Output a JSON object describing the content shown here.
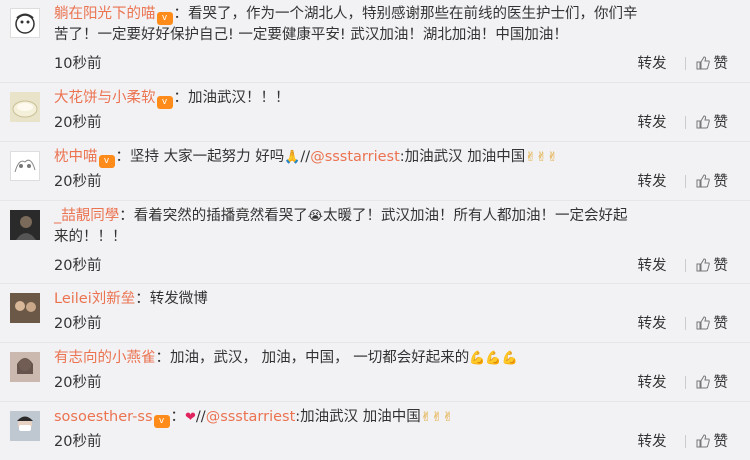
{
  "labels": {
    "repost": "转发",
    "like": "赞"
  },
  "comments": [
    {
      "user": "躺在阳光下的喵",
      "text_parts": [
        "：看哭了，作为一个湖北人，特别感谢那些在前线的医生护士们，你们辛",
        "苦了！一定要好好保护自己! 一定要健康平安! 武汉加油！湖北加油！中国加油！"
      ],
      "time": "10秒前",
      "avatar_icon": "cartoon-face-avatar"
    },
    {
      "user": "大花饼与小柔软",
      "text": "：加油武汉！！！",
      "time": "20秒前",
      "avatar_icon": "food-avatar"
    },
    {
      "user": "枕中喵",
      "text": "：坚持 大家一起努力 好吗",
      "emoji": "🙏",
      "repost_sep": "//",
      "mention": "@ssstarriest",
      "text2": ":加油武汉 加油中国",
      "emoji2": "✌✌✌",
      "time": "20秒前",
      "avatar_icon": "sketch-avatar"
    },
    {
      "user": "_喆靚同學",
      "text_parts": [
        "：看着突然的插播竟然看哭了",
        "太暖了！武汉加油！所有人都加油！一定会好起",
        "来的！！！"
      ],
      "emoji": "😭",
      "time": "20秒前",
      "avatar_icon": "dark-portrait-avatar"
    },
    {
      "user": "Leilei刘新垒",
      "text": "：转发微博",
      "time": "20秒前",
      "avatar_icon": "photo-avatar"
    },
    {
      "user": "有志向的小燕雀",
      "text": "：加油，武汉， 加油，中国， 一切都会好起来的",
      "emoji": "💪💪💪",
      "time": "20秒前",
      "avatar_icon": "girl-avatar"
    },
    {
      "user": "sosoesther-ss",
      "text": "：",
      "emoji": "❤",
      "repost_sep": "//",
      "mention": "@ssstarriest",
      "text2": ":加油武汉 加油中国",
      "emoji2": "✌✌✌",
      "time": "20秒前",
      "avatar_icon": "masked-face-avatar"
    }
  ],
  "colors": {
    "username": "#eb7350",
    "background": "#f2f2f5"
  }
}
